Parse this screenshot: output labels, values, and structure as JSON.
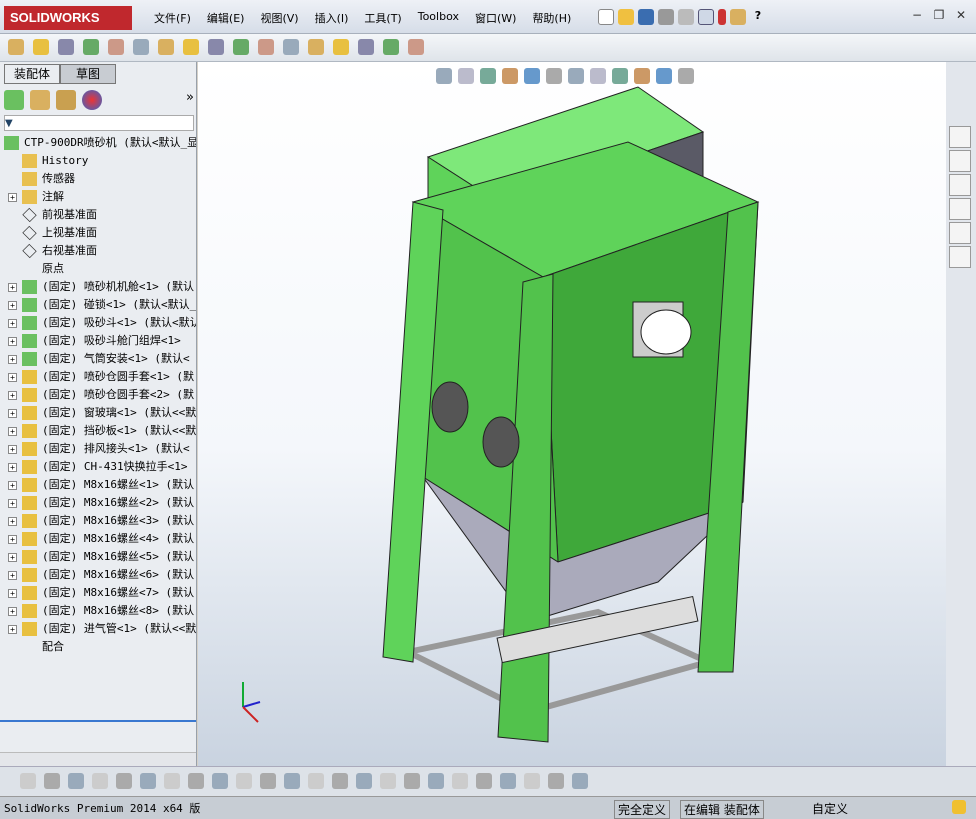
{
  "app": {
    "logo": "SOLIDWORKS"
  },
  "menu": [
    "文件(F)",
    "编辑(E)",
    "视图(V)",
    "插入(I)",
    "工具(T)",
    "Toolbox",
    "窗口(W)",
    "帮助(H)"
  ],
  "panel_tabs": [
    "装配体",
    "草图"
  ],
  "tree": [
    {
      "label": "CTP-900DR喷砂机  (默认<默认_显",
      "icon": "assembly-icon",
      "expand": false,
      "indent": 0
    },
    {
      "label": "History",
      "icon": "history-icon",
      "expand": false,
      "indent": 1
    },
    {
      "label": "传感器",
      "icon": "sensor-icon",
      "expand": false,
      "indent": 1
    },
    {
      "label": "注解",
      "icon": "annotation-icon",
      "expand": true,
      "indent": 1
    },
    {
      "label": "前视基准面",
      "icon": "plane-icon",
      "expand": false,
      "indent": 1
    },
    {
      "label": "上视基准面",
      "icon": "plane-icon",
      "expand": false,
      "indent": 1
    },
    {
      "label": "右视基准面",
      "icon": "plane-icon",
      "expand": false,
      "indent": 1
    },
    {
      "label": "原点",
      "icon": "origin-icon",
      "expand": false,
      "indent": 1
    },
    {
      "label": "(固定) 喷砂机机舱<1> (默认",
      "icon": "subassembly-icon",
      "expand": true,
      "indent": 1
    },
    {
      "label": "(固定) 碰锁<1> (默认<默认_",
      "icon": "subassembly-icon",
      "expand": true,
      "indent": 1
    },
    {
      "label": "(固定) 吸砂斗<1> (默认<默认",
      "icon": "subassembly-icon",
      "expand": true,
      "indent": 1
    },
    {
      "label": "(固定) 吸砂斗舱门组焊<1>",
      "icon": "subassembly-icon",
      "expand": true,
      "indent": 1
    },
    {
      "label": "(固定) 气筒安装<1> (默认<",
      "icon": "subassembly-icon",
      "expand": true,
      "indent": 1
    },
    {
      "label": "(固定) 喷砂仓圆手套<1> (默",
      "icon": "part-icon",
      "expand": true,
      "indent": 1
    },
    {
      "label": "(固定) 喷砂仓圆手套<2> (默",
      "icon": "part-icon",
      "expand": true,
      "indent": 1
    },
    {
      "label": "(固定) 窗玻璃<1> (默认<<默",
      "icon": "part-icon",
      "expand": true,
      "indent": 1
    },
    {
      "label": "(固定) 挡砂板<1> (默认<<默",
      "icon": "part-icon",
      "expand": true,
      "indent": 1
    },
    {
      "label": "(固定) 排风接头<1> (默认<",
      "icon": "part-icon",
      "expand": true,
      "indent": 1
    },
    {
      "label": "(固定) CH-431快换拉手<1>",
      "icon": "part-icon",
      "expand": true,
      "indent": 1
    },
    {
      "label": "(固定) M8x16螺丝<1> (默认",
      "icon": "part-icon",
      "expand": true,
      "indent": 1
    },
    {
      "label": "(固定) M8x16螺丝<2> (默认",
      "icon": "part-icon",
      "expand": true,
      "indent": 1
    },
    {
      "label": "(固定) M8x16螺丝<3> (默认",
      "icon": "part-icon",
      "expand": true,
      "indent": 1
    },
    {
      "label": "(固定) M8x16螺丝<4> (默认",
      "icon": "part-icon",
      "expand": true,
      "indent": 1
    },
    {
      "label": "(固定) M8x16螺丝<5> (默认",
      "icon": "part-icon",
      "expand": true,
      "indent": 1
    },
    {
      "label": "(固定) M8x16螺丝<6> (默认",
      "icon": "part-icon",
      "expand": true,
      "indent": 1
    },
    {
      "label": "(固定) M8x16螺丝<7> (默认",
      "icon": "part-icon",
      "expand": true,
      "indent": 1
    },
    {
      "label": "(固定) M8x16螺丝<8> (默认",
      "icon": "part-icon",
      "expand": true,
      "indent": 1
    },
    {
      "label": "(固定) 进气管<1> (默认<<默",
      "icon": "part-icon",
      "expand": true,
      "indent": 1
    },
    {
      "label": "配合",
      "icon": "mates-icon",
      "expand": false,
      "indent": 1
    }
  ],
  "status": {
    "app": "SolidWorks Premium 2014 x64 版",
    "defined": "完全定义",
    "editing": "在编辑 装配体",
    "units": "自定义"
  },
  "colors": {
    "model_green": "#5fd35a",
    "accent": "#c0282d"
  }
}
